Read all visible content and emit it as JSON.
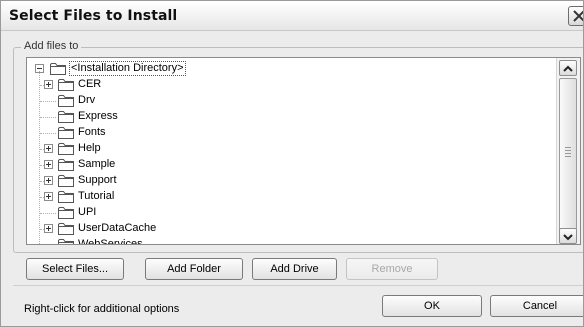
{
  "window": {
    "title": "Select Files to Install",
    "close_icon": "close-icon"
  },
  "group": {
    "label": "Add files to"
  },
  "tree": {
    "root": {
      "label": "<Installation Directory>",
      "expanded": true,
      "icon": "folder-icon"
    },
    "items": [
      {
        "label": "CER",
        "expandable": true
      },
      {
        "label": "Drv",
        "expandable": false
      },
      {
        "label": "Express",
        "expandable": false
      },
      {
        "label": "Fonts",
        "expandable": false
      },
      {
        "label": "Help",
        "expandable": true
      },
      {
        "label": "Sample",
        "expandable": true
      },
      {
        "label": "Support",
        "expandable": true
      },
      {
        "label": "Tutorial",
        "expandable": true
      },
      {
        "label": "UPI",
        "expandable": false
      },
      {
        "label": "UserDataCache",
        "expandable": true
      },
      {
        "label": "WebServices",
        "expandable": false
      }
    ],
    "scroll_up_icon": "scroll-up-arrow-icon",
    "scroll_down_icon": "scroll-down-arrow-icon"
  },
  "actions": {
    "select_files": "Select Files...",
    "add_folder": "Add Folder",
    "add_drive": "Add Drive",
    "remove": "Remove"
  },
  "footer": {
    "hint": "Right-click for additional options",
    "ok": "OK",
    "cancel": "Cancel"
  },
  "colors": {
    "window_bg": "#ececec",
    "tree_bg": "#ffffff",
    "folder_fill": "#ffffff",
    "folder_stroke": "#555555",
    "disabled_text": "#a8a8a8"
  }
}
